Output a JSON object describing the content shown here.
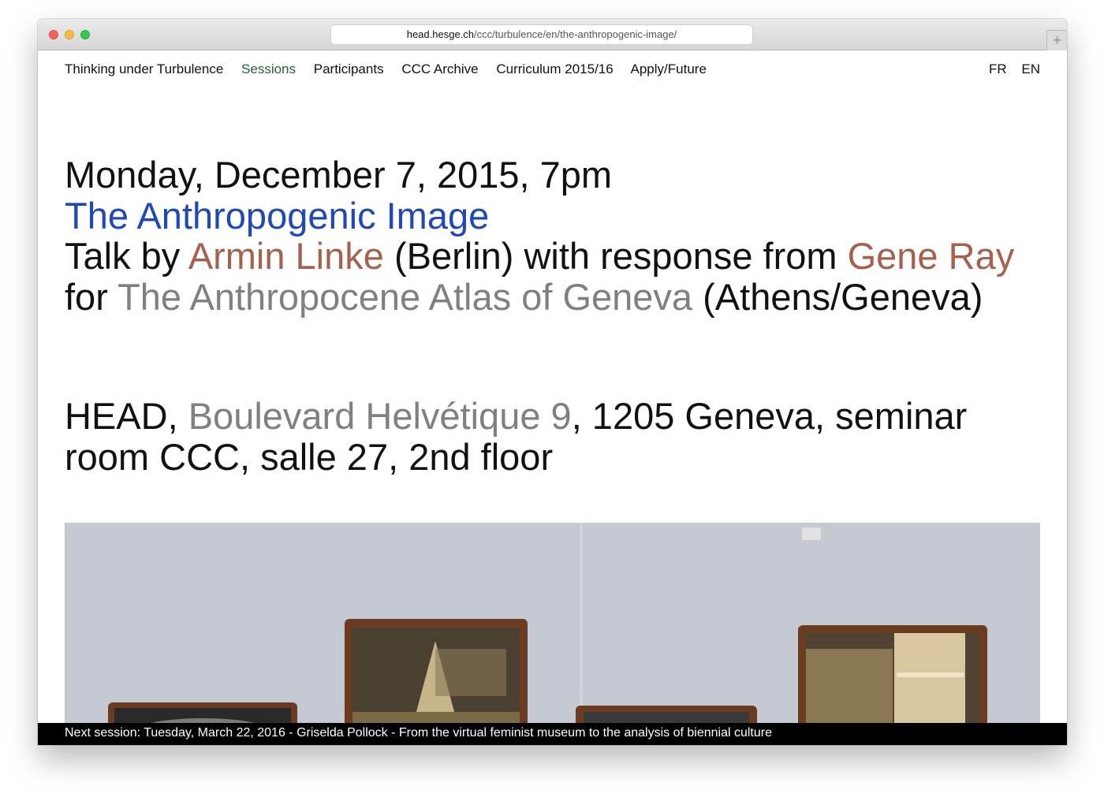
{
  "browser": {
    "url_host": "head.hesge.ch",
    "url_path": "/ccc/turbulence/en/the-anthropogenic-image/",
    "new_tab_label": "+"
  },
  "nav": {
    "items": [
      "Thinking under Turbulence",
      "Sessions",
      "Participants",
      "CCC Archive",
      "Curriculum 2015/16",
      "Apply/Future"
    ],
    "active": "Sessions",
    "languages": [
      "FR",
      "EN"
    ]
  },
  "event": {
    "date": "Monday, December 7, 2015, 7pm",
    "title": "The Anthropogenic Image",
    "talk_prefix": "Talk by ",
    "speaker": "Armin Linke",
    "speaker_city": " (Berlin) with response from ",
    "respondent": "Gene Ray",
    "for_text": " for ",
    "project": "The Anthropocene Atlas of Geneva",
    "project_city": " (Athens/Geneva)"
  },
  "venue": {
    "institution": "HEAD, ",
    "address": "Boulevard Helvétique 9",
    "rest": ", 1205 Geneva, seminar room CCC, salle 27, 2nd floor"
  },
  "ticker": {
    "text": "Next session: Tuesday, March 22, 2016 - Griselda Pollock - From the virtual feminist museum to the analysis of biennial culture"
  },
  "colors": {
    "link_blue": "#2148b8",
    "person_brown": "#a5614d",
    "place_grey": "#808080",
    "nav_active": "#2f5a37"
  }
}
